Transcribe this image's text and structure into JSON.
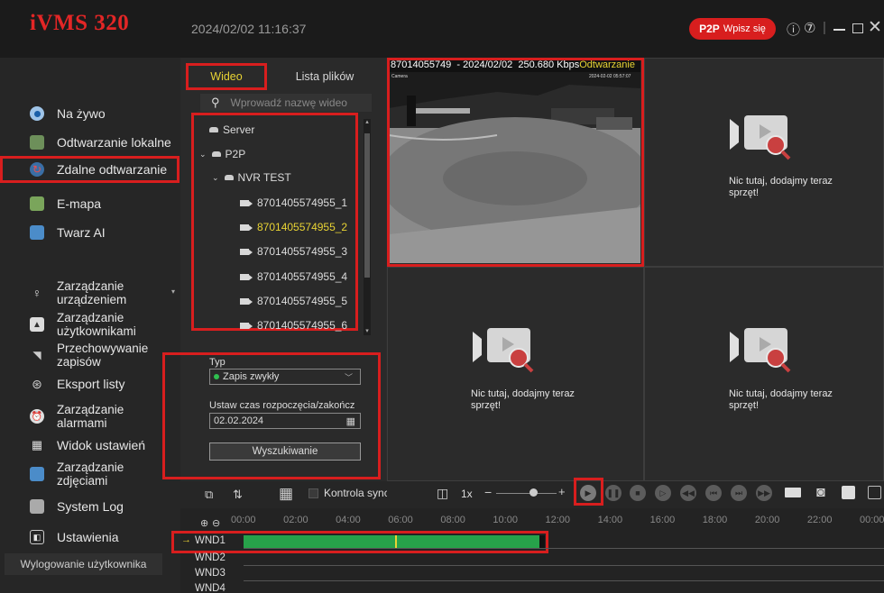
{
  "app": {
    "logo": "iVMS 320",
    "clock": "2024/02/02 11:16:37"
  },
  "topbar": {
    "p2p_bold": "P2P",
    "p2p_text": "Wpisz się",
    "icons": [
      "info-icon",
      "help-icon",
      "minimize-icon",
      "maximize-icon",
      "close-icon"
    ]
  },
  "sidebar": {
    "items": [
      {
        "label": "Na żywo",
        "icon": "live-icon"
      },
      {
        "label": "Odtwarzanie lokalne",
        "icon": "local-playback-icon"
      },
      {
        "label": "Zdalne odtwarzanie",
        "icon": "remote-playback-icon",
        "active": true
      },
      {
        "label": "E-mapa",
        "icon": "emap-icon"
      },
      {
        "label": "Twarz AI",
        "icon": "face-ai-icon"
      },
      {
        "label": "Zarządzanie urządzeniem",
        "icon": "device-icon"
      },
      {
        "label": "Zarządzanie użytkownikami",
        "icon": "users-icon"
      },
      {
        "label": "Przechowywanie zapisów",
        "icon": "storage-icon"
      },
      {
        "label": "Eksport listy",
        "icon": "export-icon"
      },
      {
        "label": "Zarządzanie alarmami",
        "icon": "alarm-icon"
      },
      {
        "label": "Widok ustawień",
        "icon": "layout-icon"
      },
      {
        "label": "Zarządzanie zdjęciami",
        "icon": "photos-icon"
      },
      {
        "label": "System Log",
        "icon": "log-icon"
      },
      {
        "label": "Ustawienia",
        "icon": "settings-icon"
      }
    ],
    "logout": "Wylogowanie użytkownika"
  },
  "files": {
    "tab_video": "Wideo",
    "tab_list": "Lista plików",
    "search_placeholder": "Wprowadź nazwę wideo",
    "tree": [
      {
        "label": "Server"
      },
      {
        "label": "P2P"
      },
      {
        "label": "NVR TEST"
      },
      {
        "label": "8701405574955_1"
      },
      {
        "label": "8701405574955_2",
        "selected": true
      },
      {
        "label": "8701405574955_3"
      },
      {
        "label": "8701405574955_4"
      },
      {
        "label": "8701405574955_5"
      },
      {
        "label": "8701405574955_6"
      }
    ],
    "type_label": "Typ",
    "type_value": "Zapis zwykły",
    "time_label": "Ustaw czas rozpoczęcia/zakończ",
    "date_value": "02.02.2024",
    "search_button": "Wyszukiwanie"
  },
  "video": {
    "id": "87014055749",
    "date": "- 2024/02/02",
    "bitrate": "250.680 Kbps",
    "status": "Odtwarzanie",
    "overlay_left": "Camera",
    "overlay_right": "2024-02-02 05:57:07",
    "empty_text": "Nic tutaj, dodajmy teraz sprzęt!"
  },
  "toolbar": {
    "sync_label": "Kontrola synchronizacji",
    "speed": "1x",
    "minus": "−",
    "plus": "+"
  },
  "timeline": {
    "ticks": [
      "00:00",
      "02:00",
      "04:00",
      "06:00",
      "08:00",
      "10:00",
      "12:00",
      "14:00",
      "16:00",
      "18:00",
      "20:00",
      "22:00",
      "00:00"
    ],
    "windows": [
      "WND1",
      "WND2",
      "WND3",
      "WND4"
    ],
    "recording_start_hour": 0,
    "recording_end_hour": 11.5,
    "cursor_hour": 5.8
  },
  "colors": {
    "accent": "#d81e1e",
    "selected_text": "#e8d334",
    "record_bar": "#27a24a",
    "status": "#e8d334"
  }
}
